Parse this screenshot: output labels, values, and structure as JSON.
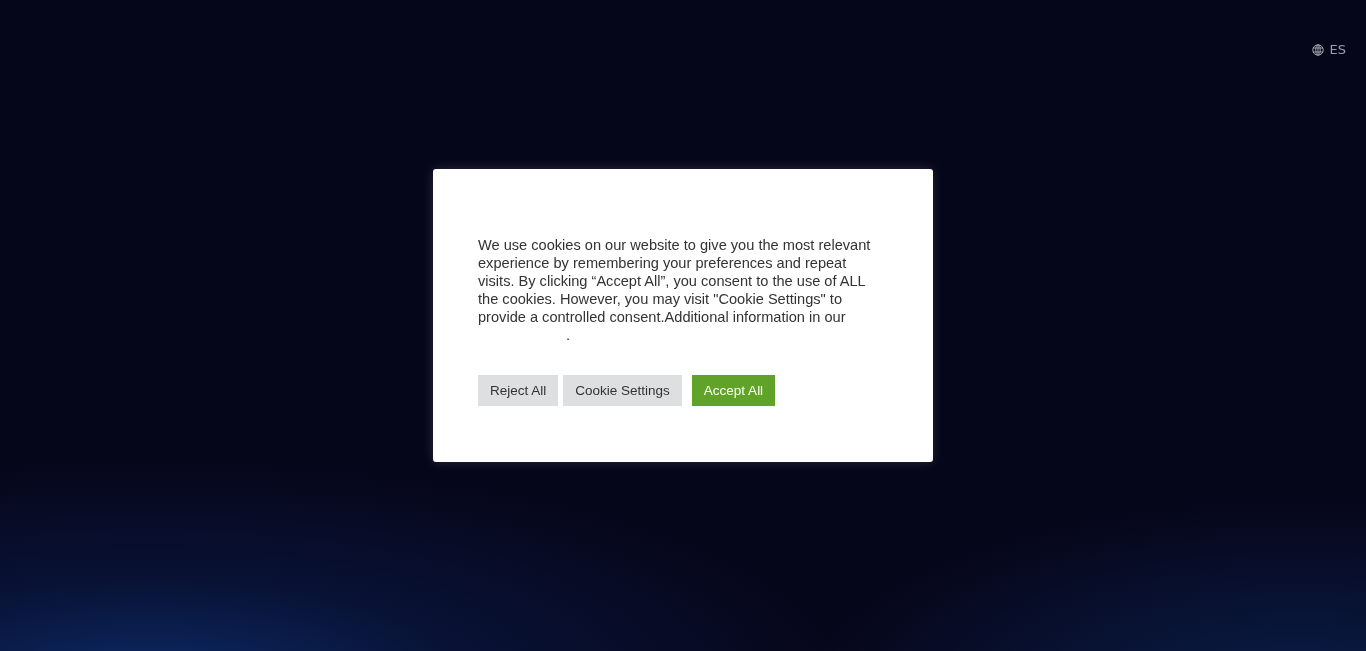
{
  "language_switch": {
    "label": "ES"
  },
  "cookie_dialog": {
    "message": "We use cookies on our website to give you the most relevant experience by remembering your preferences and repeat visits. By clicking “Accept All”, you consent to the use of ALL the cookies. However, you may visit \"Cookie Settings\" to provide a controlled consent.Additional information in our",
    "after_link": ".",
    "buttons": [
      {
        "label": "Reject All",
        "kind": "secondary"
      },
      {
        "label": "Cookie Settings",
        "kind": "secondary"
      },
      {
        "label": "Accept All",
        "kind": "primary"
      }
    ]
  }
}
